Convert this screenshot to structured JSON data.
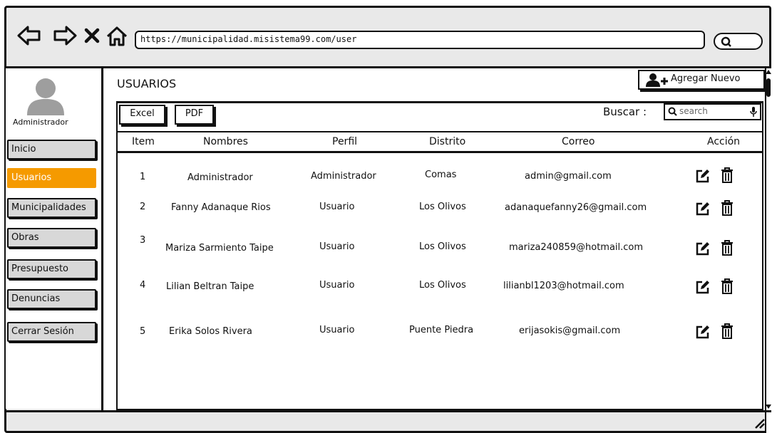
{
  "browser": {
    "url": "https://municipalidad.misistema99.com/user"
  },
  "sidebar": {
    "user_label": "Administrador",
    "items": [
      {
        "label": "Inicio"
      },
      {
        "label": "Usuarios"
      },
      {
        "label": "Municipalidades"
      },
      {
        "label": "Obras"
      },
      {
        "label": "Presupuesto"
      },
      {
        "label": "Denuncias"
      },
      {
        "label": "Cerrar Sesión"
      }
    ]
  },
  "main": {
    "title": "USUARIOS",
    "add_button": "Agregar Nuevo",
    "excel_button": "Excel",
    "pdf_button": "PDF",
    "search_label": "Buscar :",
    "search_placeholder": "search",
    "columns": [
      "Item",
      "Nombres",
      "Perfil",
      "Distrito",
      "Correo",
      "Acción"
    ],
    "rows": [
      {
        "item": "1",
        "nombre": "Administrador",
        "perfil": "Administrador",
        "distrito": "Comas",
        "correo": "admin@gmail.com"
      },
      {
        "item": "2",
        "nombre": "Fanny Adanaque Rios",
        "perfil": "Usuario",
        "distrito": "Los Olivos",
        "correo": "adanaquefanny26@gmail.com"
      },
      {
        "item": "3",
        "nombre": "Mariza Sarmiento Taipe",
        "perfil": "Usuario",
        "distrito": "Los Olivos",
        "correo": "mariza240859@hotmail.com"
      },
      {
        "item": "4",
        "nombre": "Lilian Beltran Taipe",
        "perfil": "Usuario",
        "distrito": "Los Olivos",
        "correo": "lilianbl1203@hotmail.com"
      },
      {
        "item": "5",
        "nombre": "Erika Solos Rivera",
        "perfil": "Usuario",
        "distrito": "Puente Piedra",
        "correo": "erijasokis@gmail.com"
      }
    ]
  },
  "colors": {
    "active_nav": "#f59a00",
    "nav_bg": "#d8d8d8",
    "chrome_bg": "#e9e9e9"
  },
  "icons": {
    "back": "arrow-left-icon",
    "forward": "arrow-right-icon",
    "close": "close-icon",
    "home": "home-icon",
    "search": "search-icon",
    "edit": "edit-icon",
    "delete": "trash-icon",
    "add_user": "add-user-icon",
    "mic": "microphone-icon"
  }
}
